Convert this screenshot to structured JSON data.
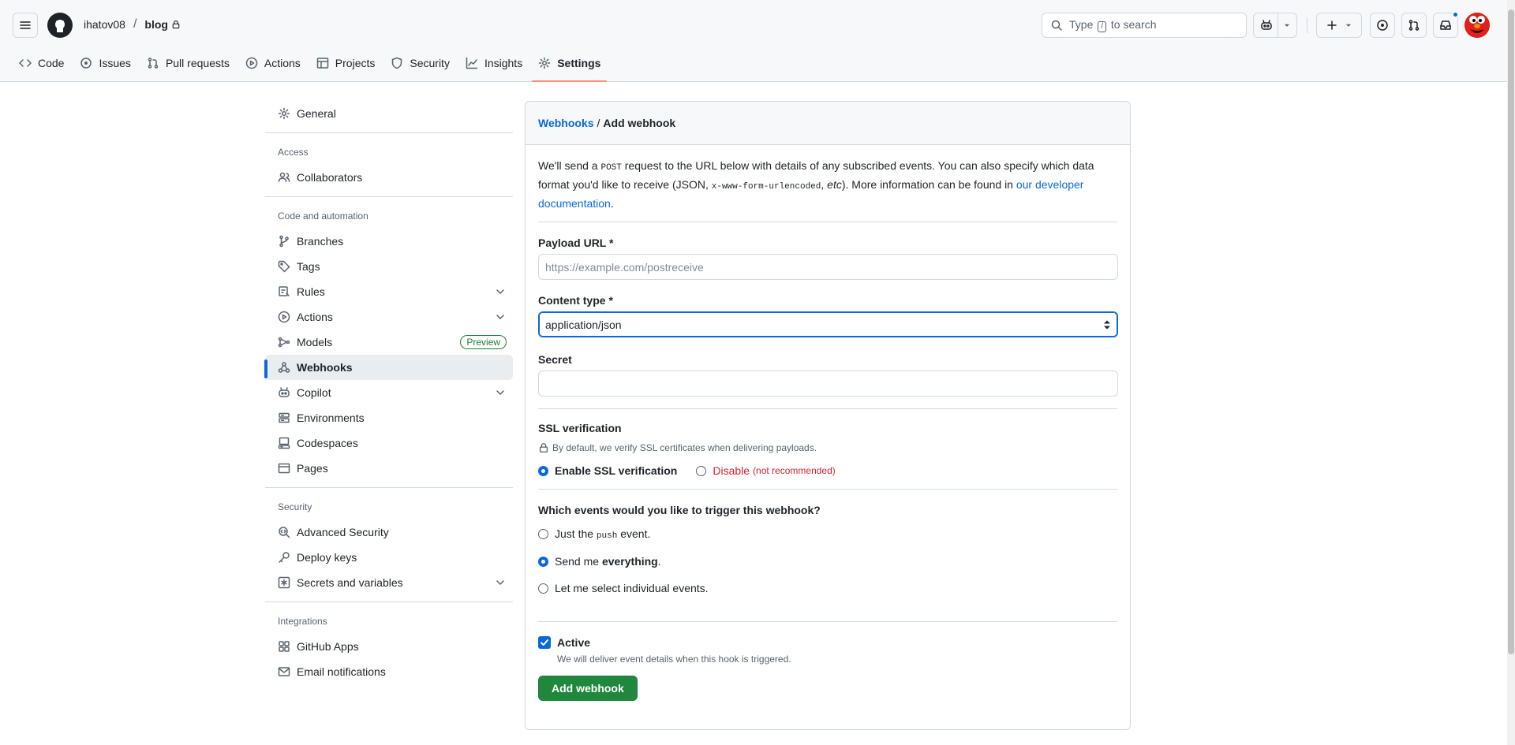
{
  "header": {
    "owner": "ihatov08",
    "separator": "/",
    "repo": "blog",
    "search_prefix": "Type",
    "search_key": "/",
    "search_suffix": "to search"
  },
  "tabs": [
    {
      "label": "Code",
      "icon": "code-icon"
    },
    {
      "label": "Issues",
      "icon": "issue-icon"
    },
    {
      "label": "Pull requests",
      "icon": "pull-request-icon"
    },
    {
      "label": "Actions",
      "icon": "play-icon"
    },
    {
      "label": "Projects",
      "icon": "table-icon"
    },
    {
      "label": "Security",
      "icon": "shield-icon"
    },
    {
      "label": "Insights",
      "icon": "graph-icon"
    },
    {
      "label": "Settings",
      "icon": "gear-icon"
    }
  ],
  "sidebar": {
    "general": "General",
    "access_heading": "Access",
    "collaborators": "Collaborators",
    "code_heading": "Code and automation",
    "branches": "Branches",
    "tags": "Tags",
    "rules": "Rules",
    "actions": "Actions",
    "models": "Models",
    "models_badge": "Preview",
    "webhooks": "Webhooks",
    "copilot": "Copilot",
    "environments": "Environments",
    "codespaces": "Codespaces",
    "pages": "Pages",
    "security_heading": "Security",
    "advanced_security": "Advanced Security",
    "deploy_keys": "Deploy keys",
    "secrets": "Secrets and variables",
    "integrations_heading": "Integrations",
    "github_apps": "GitHub Apps",
    "email_notifications": "Email notifications"
  },
  "panel": {
    "crumb_link": "Webhooks",
    "crumb_sep": "/",
    "crumb_current": "Add webhook",
    "intro_1": "We'll send a",
    "intro_post": "POST",
    "intro_2": "request to the URL below with details of any subscribed events. You can also specify which data format you'd like to receive (JSON,",
    "intro_form": "x-www-form-urlencoded",
    "intro_etc": "etc",
    "intro_3": "). More information can be found in",
    "intro_link": "our developer documentation",
    "intro_end": ".",
    "payload_label": "Payload URL *",
    "payload_placeholder": "https://example.com/postreceive",
    "content_label": "Content type *",
    "content_value": "application/json",
    "secret_label": "Secret",
    "ssl_label": "SSL verification",
    "ssl_note": "By default, we verify SSL certificates when delivering payloads.",
    "ssl_enable": "Enable SSL verification",
    "ssl_disable": "Disable",
    "ssl_disable_note": "(not recommended)",
    "events_label": "Which events would you like to trigger this webhook?",
    "event_push_1": "Just the",
    "event_push_code": "push",
    "event_push_2": "event.",
    "event_all_1": "Send me",
    "event_all_bold": "everything",
    "event_all_2": ".",
    "event_select": "Let me select individual events.",
    "active_label": "Active",
    "active_note": "We will deliver event details when this hook is triggered.",
    "submit": "Add webhook"
  }
}
